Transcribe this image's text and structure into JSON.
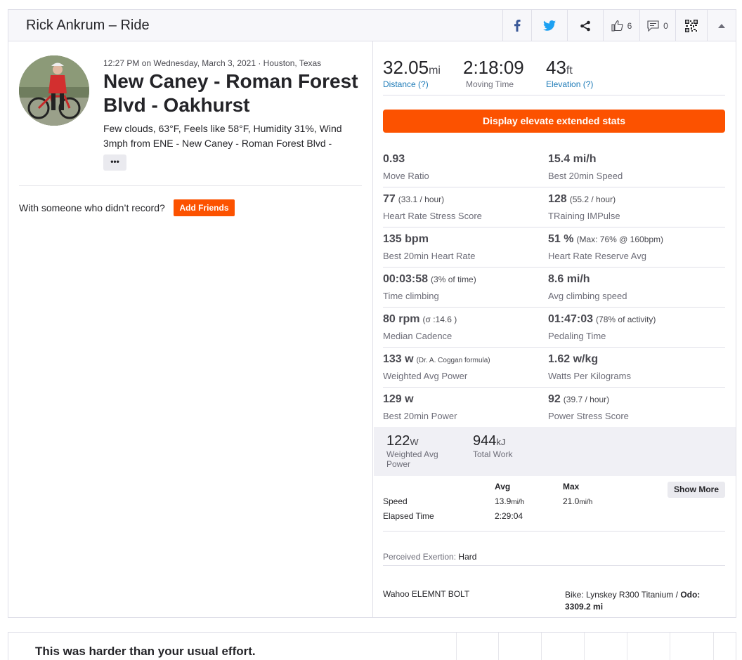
{
  "header": {
    "title": "Rick Ankrum – Ride",
    "kudos_count": "6",
    "comment_count": "0",
    "icons": [
      "facebook-icon",
      "twitter-icon",
      "share-icon",
      "thumbs-up-icon",
      "comment-icon",
      "qr-code-icon",
      "caret-up-icon"
    ]
  },
  "activity": {
    "meta": "12:27 PM on Wednesday, March 3, 2021 · Houston, Texas",
    "title": "New Caney - Roman Forest Blvd - Oakhurst",
    "description": "Few clouds, 63°F, Feels like 58°F, Humidity 31%, Wind 3mph from ENE - New Caney - Roman Forest Blvd -",
    "more_label": "•••",
    "with_someone": "With someone who didn’t record?",
    "add_friends": "Add Friends"
  },
  "summary": {
    "distance": {
      "value": "32.05",
      "unit": "mi",
      "label": "Distance (?)"
    },
    "moving_time": {
      "value": "2:18:09",
      "label": "Moving Time"
    },
    "elevation": {
      "value": "43",
      "unit": "ft",
      "label": "Elevation (?)"
    }
  },
  "elevate_button": "Display elevate extended stats",
  "extended_stats": [
    {
      "left": {
        "value": "0.93",
        "sub": "",
        "label": "Move Ratio"
      },
      "right": {
        "value": "15.4 mi/h",
        "sub": "",
        "label": "Best 20min Speed"
      }
    },
    {
      "left": {
        "value": "77",
        "sub": "(33.1 / hour)",
        "label": "Heart Rate Stress Score"
      },
      "right": {
        "value": "128",
        "sub": "(55.2 / hour)",
        "label": "TRaining IMPulse"
      }
    },
    {
      "left": {
        "value": "135 bpm",
        "sub": "",
        "label": "Best 20min Heart Rate"
      },
      "right": {
        "value": "51 %",
        "sub": "(Max: 76% @ 160bpm)",
        "label": "Heart Rate Reserve Avg"
      }
    },
    {
      "left": {
        "value": "00:03:58",
        "sub": "(3% of time)",
        "label": "Time climbing"
      },
      "right": {
        "value": "8.6 mi/h",
        "sub": "",
        "label": "Avg climbing speed"
      }
    },
    {
      "left": {
        "value": "80 rpm",
        "sub": "(σ :14.6 )",
        "label": "Median Cadence"
      },
      "right": {
        "value": "01:47:03",
        "sub": "(78% of activity)",
        "label": "Pedaling Time"
      }
    },
    {
      "left": {
        "value": "133 w",
        "sub": "(Dr. A. Coggan formula)",
        "label": "Weighted Avg Power"
      },
      "right": {
        "value": "1.62 w/kg",
        "sub": "",
        "label": "Watts Per Kilograms"
      }
    },
    {
      "left": {
        "value": "129 w",
        "sub": "",
        "label": "Best 20min Power"
      },
      "right": {
        "value": "92",
        "sub": "(39.7 / hour)",
        "label": "Power Stress Score"
      }
    }
  ],
  "power": {
    "weighted_avg": {
      "value": "122",
      "unit": "W",
      "label_line1": "Weighted Avg",
      "label_line2": "Power"
    },
    "total_work": {
      "value": "944",
      "unit": "kJ",
      "label": "Total Work"
    }
  },
  "more_stats": {
    "col_avg": "Avg",
    "col_max": "Max",
    "show_more": "Show More",
    "speed": {
      "label": "Speed",
      "avg": "13.9",
      "avg_unit": "mi/h",
      "max": "21.0",
      "max_unit": "mi/h"
    },
    "elapsed": {
      "label": "Elapsed Time",
      "avg": "2:29:04"
    }
  },
  "perceived": {
    "label": "Perceived Exertion:",
    "value": "Hard"
  },
  "device": "Wahoo ELEMNT BOLT",
  "bike": {
    "label": "Bike: Lynskey R300 Titanium /",
    "odo_label": "Odo:",
    "odo_value": "3309.2 mi"
  },
  "bottom": {
    "text": "This was harder than your usual effort."
  },
  "colors": {
    "accent": "#fc5200",
    "link": "#1c7ab7"
  }
}
